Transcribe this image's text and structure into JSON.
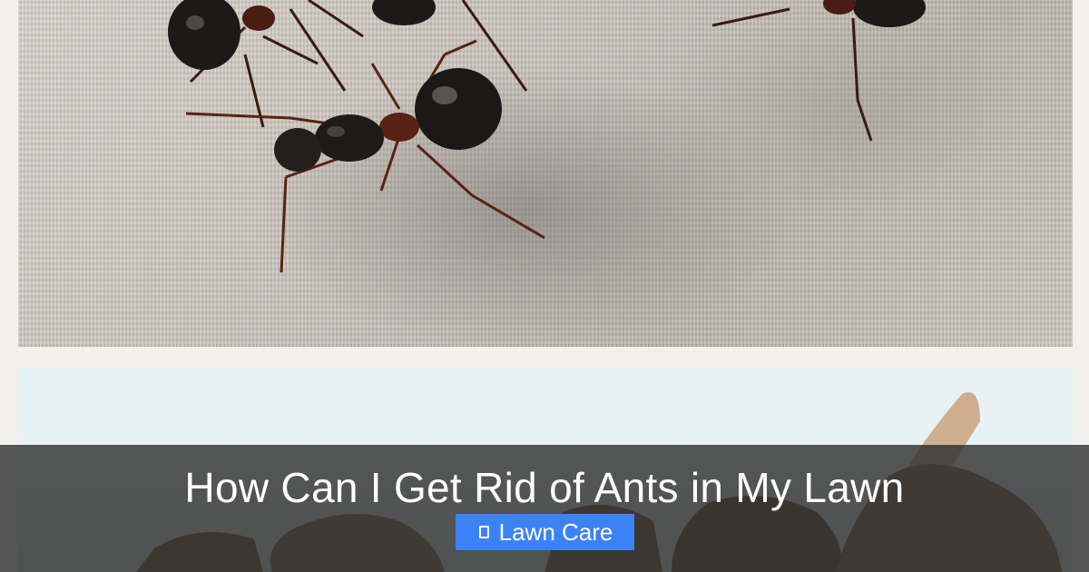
{
  "post": {
    "title": "How Can I Get Rid of Ants in My Lawn",
    "category": "Lawn Care",
    "category_icon": "tag-icon"
  },
  "colors": {
    "overlay": "#2d2d2d",
    "badge": "#3b82f6",
    "text": "#ffffff"
  }
}
